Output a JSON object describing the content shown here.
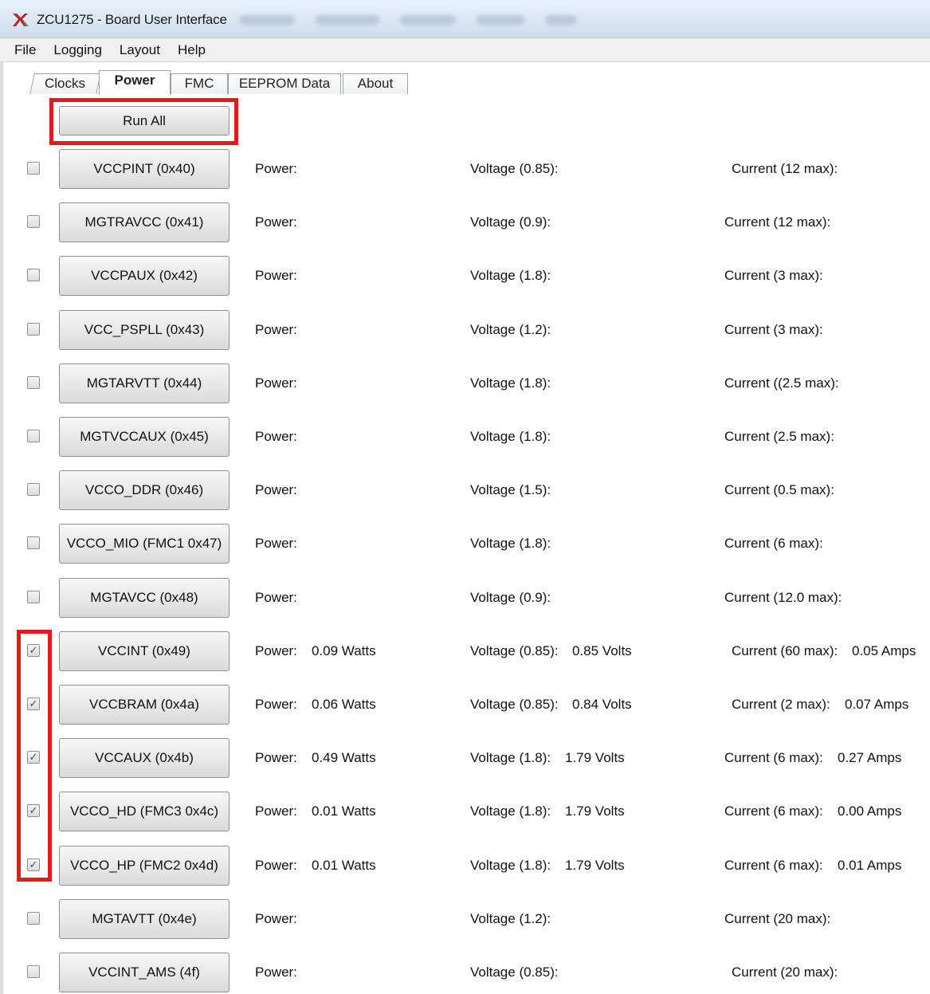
{
  "window": {
    "title": "ZCU1275 - Board User Interface"
  },
  "menu": [
    "File",
    "Logging",
    "Layout",
    "Help"
  ],
  "tabs": [
    {
      "label": "Clocks",
      "active": false
    },
    {
      "label": "Power",
      "active": true
    },
    {
      "label": "FMC",
      "active": false
    },
    {
      "label": "EEPROM Data",
      "active": false
    },
    {
      "label": "About",
      "active": false
    }
  ],
  "run_all_label": "Run All",
  "highlight_color": "#e21c1c",
  "rails": [
    {
      "name": "VCCPINT (0x40)",
      "checked": false,
      "power": "Power:",
      "power_value": "",
      "voltage": "Voltage (0.85):",
      "voltage_value": "",
      "current": "Current (12 max):",
      "current_value": ""
    },
    {
      "name": "MGTRAVCC (0x41)",
      "checked": false,
      "power": "Power:",
      "power_value": "",
      "voltage": "Voltage (0.9):",
      "voltage_value": "",
      "current": "Current (12 max):",
      "current_value": ""
    },
    {
      "name": "VCCPAUX (0x42)",
      "checked": false,
      "power": "Power:",
      "power_value": "",
      "voltage": "Voltage (1.8):",
      "voltage_value": "",
      "current": "Current (3 max):",
      "current_value": ""
    },
    {
      "name": "VCC_PSPLL (0x43)",
      "checked": false,
      "power": "Power:",
      "power_value": "",
      "voltage": "Voltage (1.2):",
      "voltage_value": "",
      "current": "Current (3 max):",
      "current_value": ""
    },
    {
      "name": "MGTARVTT (0x44)",
      "checked": false,
      "power": "Power:",
      "power_value": "",
      "voltage": "Voltage (1.8):",
      "voltage_value": "",
      "current": "Current ((2.5 max):",
      "current_value": ""
    },
    {
      "name": "MGTVCCAUX (0x45)",
      "checked": false,
      "power": "Power:",
      "power_value": "",
      "voltage": "Voltage (1.8):",
      "voltage_value": "",
      "current": "Current (2.5 max):",
      "current_value": ""
    },
    {
      "name": "VCCO_DDR (0x46)",
      "checked": false,
      "power": "Power:",
      "power_value": "",
      "voltage": "Voltage (1.5):",
      "voltage_value": "",
      "current": "Current (0.5 max):",
      "current_value": ""
    },
    {
      "name": "VCCO_MIO (FMC1 0x47)",
      "checked": false,
      "power": "Power:",
      "power_value": "",
      "voltage": "Voltage (1.8):",
      "voltage_value": "",
      "current": "Current (6 max):",
      "current_value": ""
    },
    {
      "name": "MGTAVCC (0x48)",
      "checked": false,
      "power": "Power:",
      "power_value": "",
      "voltage": "Voltage (0.9):",
      "voltage_value": "",
      "current": "Current (12.0 max):",
      "current_value": ""
    },
    {
      "name": "VCCINT (0x49)",
      "checked": true,
      "power": "Power:",
      "power_value": "0.09 Watts",
      "voltage": "Voltage (0.85):",
      "voltage_value": "0.85 Volts",
      "current": "Current (60 max):",
      "current_value": "0.05 Amps"
    },
    {
      "name": "VCCBRAM (0x4a)",
      "checked": true,
      "power": "Power:",
      "power_value": "0.06 Watts",
      "voltage": "Voltage (0.85):",
      "voltage_value": "0.84 Volts",
      "current": "Current (2 max):",
      "current_value": "0.07 Amps"
    },
    {
      "name": "VCCAUX (0x4b)",
      "checked": true,
      "power": "Power:",
      "power_value": "0.49 Watts",
      "voltage": "Voltage (1.8):",
      "voltage_value": "1.79 Volts",
      "current": "Current (6 max):",
      "current_value": "0.27 Amps"
    },
    {
      "name": "VCCO_HD (FMC3 0x4c)",
      "checked": true,
      "power": "Power:",
      "power_value": "0.01 Watts",
      "voltage": "Voltage (1.8):",
      "voltage_value": "1.79 Volts",
      "current": "Current (6 max):",
      "current_value": "0.00 Amps"
    },
    {
      "name": "VCCO_HP (FMC2 0x4d)",
      "checked": true,
      "power": "Power:",
      "power_value": "0.01 Watts",
      "voltage": "Voltage (1.8):",
      "voltage_value": "1.79 Volts",
      "current": "Current (6 max):",
      "current_value": "0.01 Amps"
    },
    {
      "name": "MGTAVTT (0x4e)",
      "checked": false,
      "power": "Power:",
      "power_value": "",
      "voltage": "Voltage (1.2):",
      "voltage_value": "",
      "current": "Current (20 max):",
      "current_value": ""
    },
    {
      "name": "VCCINT_AMS (4f)",
      "checked": false,
      "power": "Power:",
      "power_value": "",
      "voltage": "Voltage (0.85):",
      "voltage_value": "",
      "current": "Current (20 max):",
      "current_value": ""
    }
  ]
}
